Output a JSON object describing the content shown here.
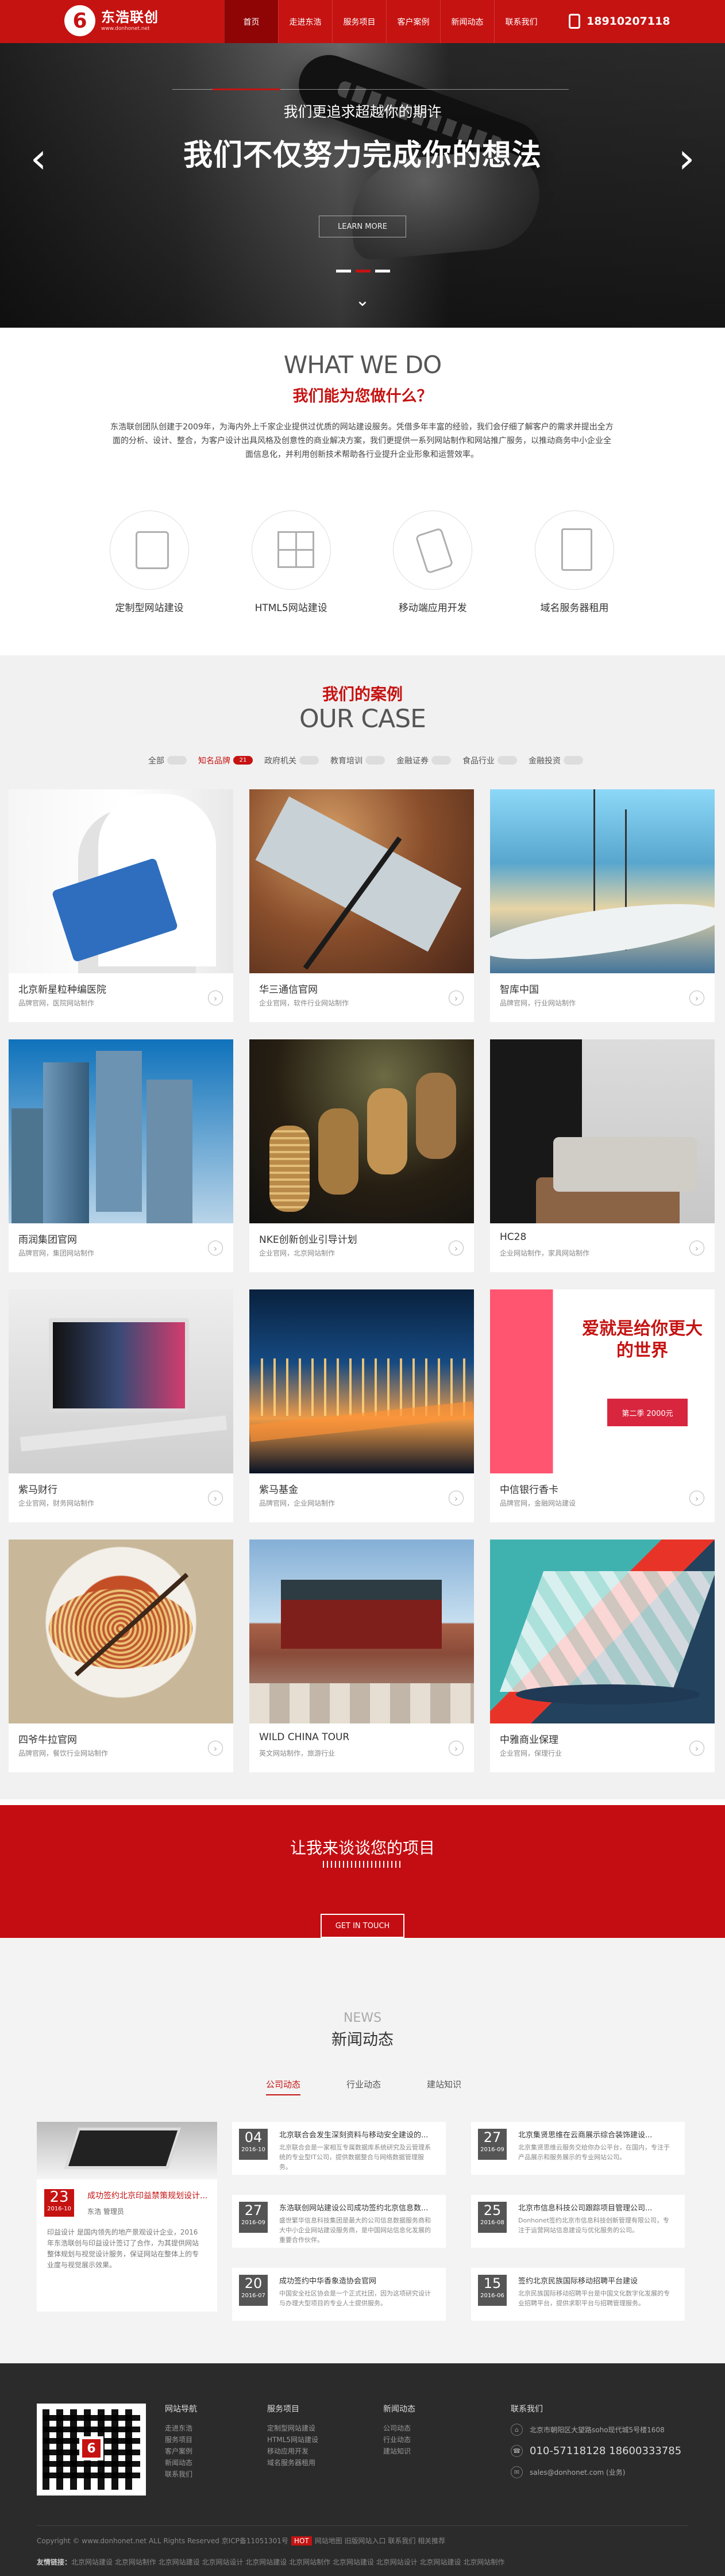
{
  "header": {
    "logo_mark": "6",
    "logo_name": "东浩联创",
    "logo_url": "www.donhonet.net",
    "nav": [
      "首页",
      "走进东浩",
      "服务项目",
      "客户案例",
      "新闻动态",
      "联系我们"
    ],
    "phone": "18910207118",
    "icons": {
      "phone": "phone-icon"
    },
    "colors": {
      "primary": "#c51312",
      "active": "#8f0404"
    }
  },
  "hero": {
    "subtitle": "我们更追求超越你的期许",
    "title": "我们不仅努力完成你的想法",
    "button": "LEARN MORE",
    "prev": "‹",
    "next": "›",
    "down": "⌄"
  },
  "what": {
    "title_en": "WHAT WE DO",
    "title_cn": "我们能为您做什么？",
    "intro": "东浩联创团队创建于2009年，为海内外上千家企业提供过优质的网站建设服务。凭借多年丰富的经验，我们会仔细了解客户的需求并提出全方面的分析、设计、整合，为客户设计出具风格及创意性的商业解决方案，我们更提供一系列网站制作和网站推广服务，以推动商务中小企业全面信息化，并利用创新技术帮助各行业提升企业形象和运营效率。",
    "services": [
      {
        "label": "定制型网站建设",
        "icon": "devices-icon"
      },
      {
        "label": "HTML5网站建设",
        "icon": "html5-icon"
      },
      {
        "label": "移动端应用开发",
        "icon": "mobile-icon"
      },
      {
        "label": "域名服务器租用",
        "icon": "server-icon"
      }
    ]
  },
  "case": {
    "title_cn": "我们的案例",
    "title_en": "OUR CASE",
    "filters": [
      {
        "label": "全部",
        "count": ""
      },
      {
        "label": "知名品牌",
        "count": "21"
      },
      {
        "label": "政府机关",
        "count": ""
      },
      {
        "label": "教育培训",
        "count": ""
      },
      {
        "label": "金融证券",
        "count": ""
      },
      {
        "label": "食品行业",
        "count": ""
      },
      {
        "label": "金融投资",
        "count": ""
      }
    ],
    "items": [
      {
        "title": "北京新星粒种编医院",
        "desc": "品牌官网，医院网站制作"
      },
      {
        "title": "华三通信官网",
        "desc": "企业官网，软件行业网站制作"
      },
      {
        "title": "智库中国",
        "desc": "品牌官网，行业网站制作"
      },
      {
        "title": "雨润集团官网",
        "desc": "品牌官网，集团网站制作"
      },
      {
        "title": "NKE创新创业引导计划",
        "desc": "企业官网，北京网站制作"
      },
      {
        "title": "HC28",
        "desc": "企业网站制作，家具网站制作"
      },
      {
        "title": "紫马财行",
        "desc": "企业官网，财务网站制作"
      },
      {
        "title": "紫马基金",
        "desc": "品牌官网，企业网站制作"
      },
      {
        "title": "中信银行香卡",
        "desc": "品牌官网，金融网站建设"
      },
      {
        "title": "四爷牛拉官网",
        "desc": "品牌官网，餐饮行业网站制作"
      },
      {
        "title": "WILD CHINA TOUR",
        "desc": "英文网站制作，旅游行业"
      },
      {
        "title": "中雅商业保理",
        "desc": "企业官网，保理行业"
      }
    ],
    "card_text": "爱就是给你更大的世界",
    "card_badge": "第二季 2000元"
  },
  "cta": {
    "title": "让我来谈谈您的项目",
    "button": "GET IN TOUCH"
  },
  "news": {
    "title_en": "NEWS",
    "title_cn": "新闻动态",
    "tabs": [
      "公司动态",
      "行业动态",
      "建站知识"
    ],
    "feature": {
      "day": "23",
      "month": "2016-10",
      "title": "成功签约北京印益禁策规划设计...",
      "meta": "东浩 管理员",
      "text": "印益设计 是国内领先的地产景观设计企业，2016年东浩联创与印益设计签订了合作，为其提供网站整体规划与视觉设计服务，保证网站在整体上的专业度与视觉展示效果。"
    },
    "items": [
      {
        "day": "04",
        "month": "2016-10",
        "title": "北京联合会发生深刻资料与移动安全建设的...",
        "text": "北京联合会是一家相互专属数据库系统研究及云管理系统的专业型IT公司，提供数据整合与网络数据管理服务。"
      },
      {
        "day": "27",
        "month": "2016-09",
        "title": "北京集贤思维在云商展示综合装饰建设...",
        "text": "北京集贤思维云服务交给你办公平台，在国内，专注于产品展示和服务展示的专业网站公司。"
      },
      {
        "day": "27",
        "month": "2016-09",
        "title": "东浩联创网站建设公司成功签约北京信息数...",
        "text": "盛世繁华信息科技集团是最大的公司信息数据服务商和大中小企业网站建设服务商，是中国网站信息化发展的重要合作伙伴。"
      },
      {
        "day": "25",
        "month": "2016-08",
        "title": "北京市信息科技公司跟踪项目管理公司...",
        "text": "Donhonet签约北京市信息科技创新管理有限公司，专注于运营网站信息建设与优化服务的公司。"
      },
      {
        "day": "20",
        "month": "2016-07",
        "title": "成功签约中华香象造协会官网",
        "text": "中国安全社区协会是一个正式社团，因为这项研究设计与办理大型项目的专业人士提供服务。"
      },
      {
        "day": "15",
        "month": "2016-06",
        "title": "签约北京民族国际移动招聘平台建设",
        "text": "北京民族国际移动招聘平台是中国文化数字化发展的专业招聘平台，提供求职平台与招聘管理服务。"
      }
    ]
  },
  "footer": {
    "qr_mark": "6",
    "cols": [
      {
        "head": "网站导航",
        "links": [
          "走进东浩",
          "服务项目",
          "客户案例",
          "新闻动态",
          "联系我们"
        ]
      },
      {
        "head": "服务项目",
        "links": [
          "定制型网站建设",
          "HTML5网站建设",
          "移动应用开发",
          "域名服务器租用"
        ]
      },
      {
        "head": "新闻动态",
        "links": [
          "公司动态",
          "行业动态",
          "建站知识"
        ]
      }
    ],
    "contact_head": "联系我们",
    "address": "北京市朝阳区大望路soho现代城5号楼1608",
    "phone": "010-57118128 18600333785",
    "email": "sales@donhonet.com (业务)",
    "copyright": "Copyright © www.donhonet.net ALL Rights Reserved 京ICP备11051301号",
    "copy_badge": "HOT",
    "copy_links": "网站地图 旧版网站入口 联系我们 相关推荐",
    "friend_label": "友情链接：",
    "friend_links": "北京网站建设  北京网站制作  北京网站建设  北京网站设计  北京网站建设  北京网站制作  北京网站建设  北京网站设计  北京网站建设  北京网站制作"
  }
}
